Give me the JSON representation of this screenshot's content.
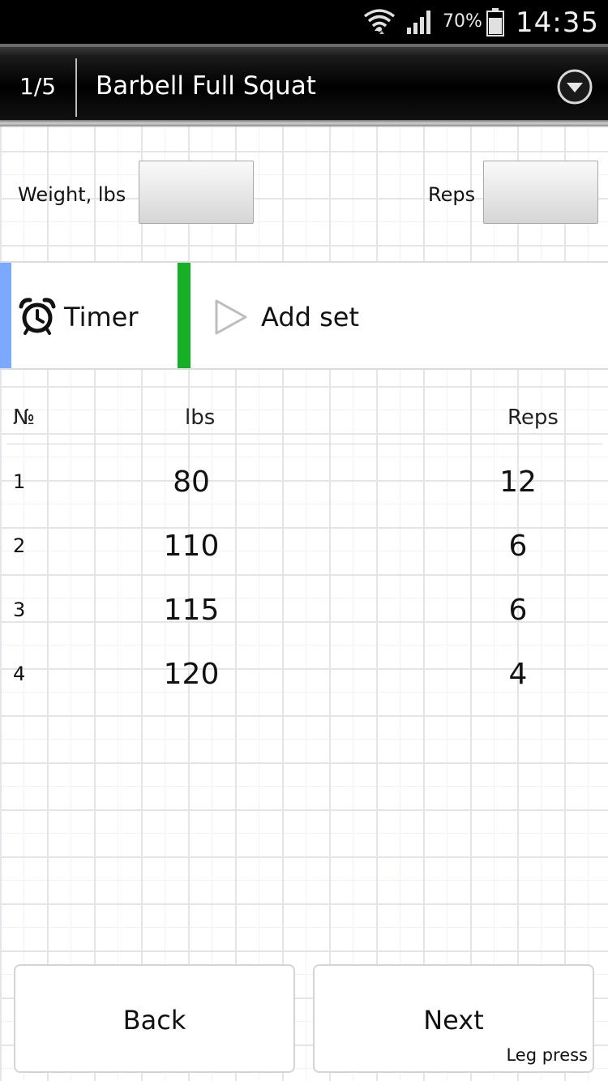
{
  "status_bar": {
    "battery_percent": "70%",
    "battery_symbol": "%",
    "time": "14:35",
    "icons": [
      "wifi-icon",
      "signal-icon",
      "battery-icon"
    ]
  },
  "header": {
    "counter": "1/5",
    "title": "Barbell Full Squat",
    "menu_icon": "chevron-down-circle-icon"
  },
  "inputs": {
    "weight_label": "Weight, lbs",
    "weight_value": "",
    "reps_label": "Reps",
    "reps_value": ""
  },
  "actions": {
    "timer_label": "Timer",
    "timer_icon": "alarm-clock-icon",
    "timer_accent": "#7aa9ff",
    "add_set_label": "Add set",
    "add_set_icon": "play-icon",
    "add_set_accent": "#16b026"
  },
  "sets_table": {
    "headers": {
      "num": "№",
      "lbs": "lbs",
      "reps": "Reps"
    },
    "rows": [
      {
        "num": "1",
        "lbs": "80",
        "reps": "12"
      },
      {
        "num": "2",
        "lbs": "110",
        "reps": "6"
      },
      {
        "num": "3",
        "lbs": "115",
        "reps": "6"
      },
      {
        "num": "4",
        "lbs": "120",
        "reps": "4"
      }
    ]
  },
  "footer": {
    "back_label": "Back",
    "next_label": "Next",
    "next_exercise": "Leg press"
  }
}
